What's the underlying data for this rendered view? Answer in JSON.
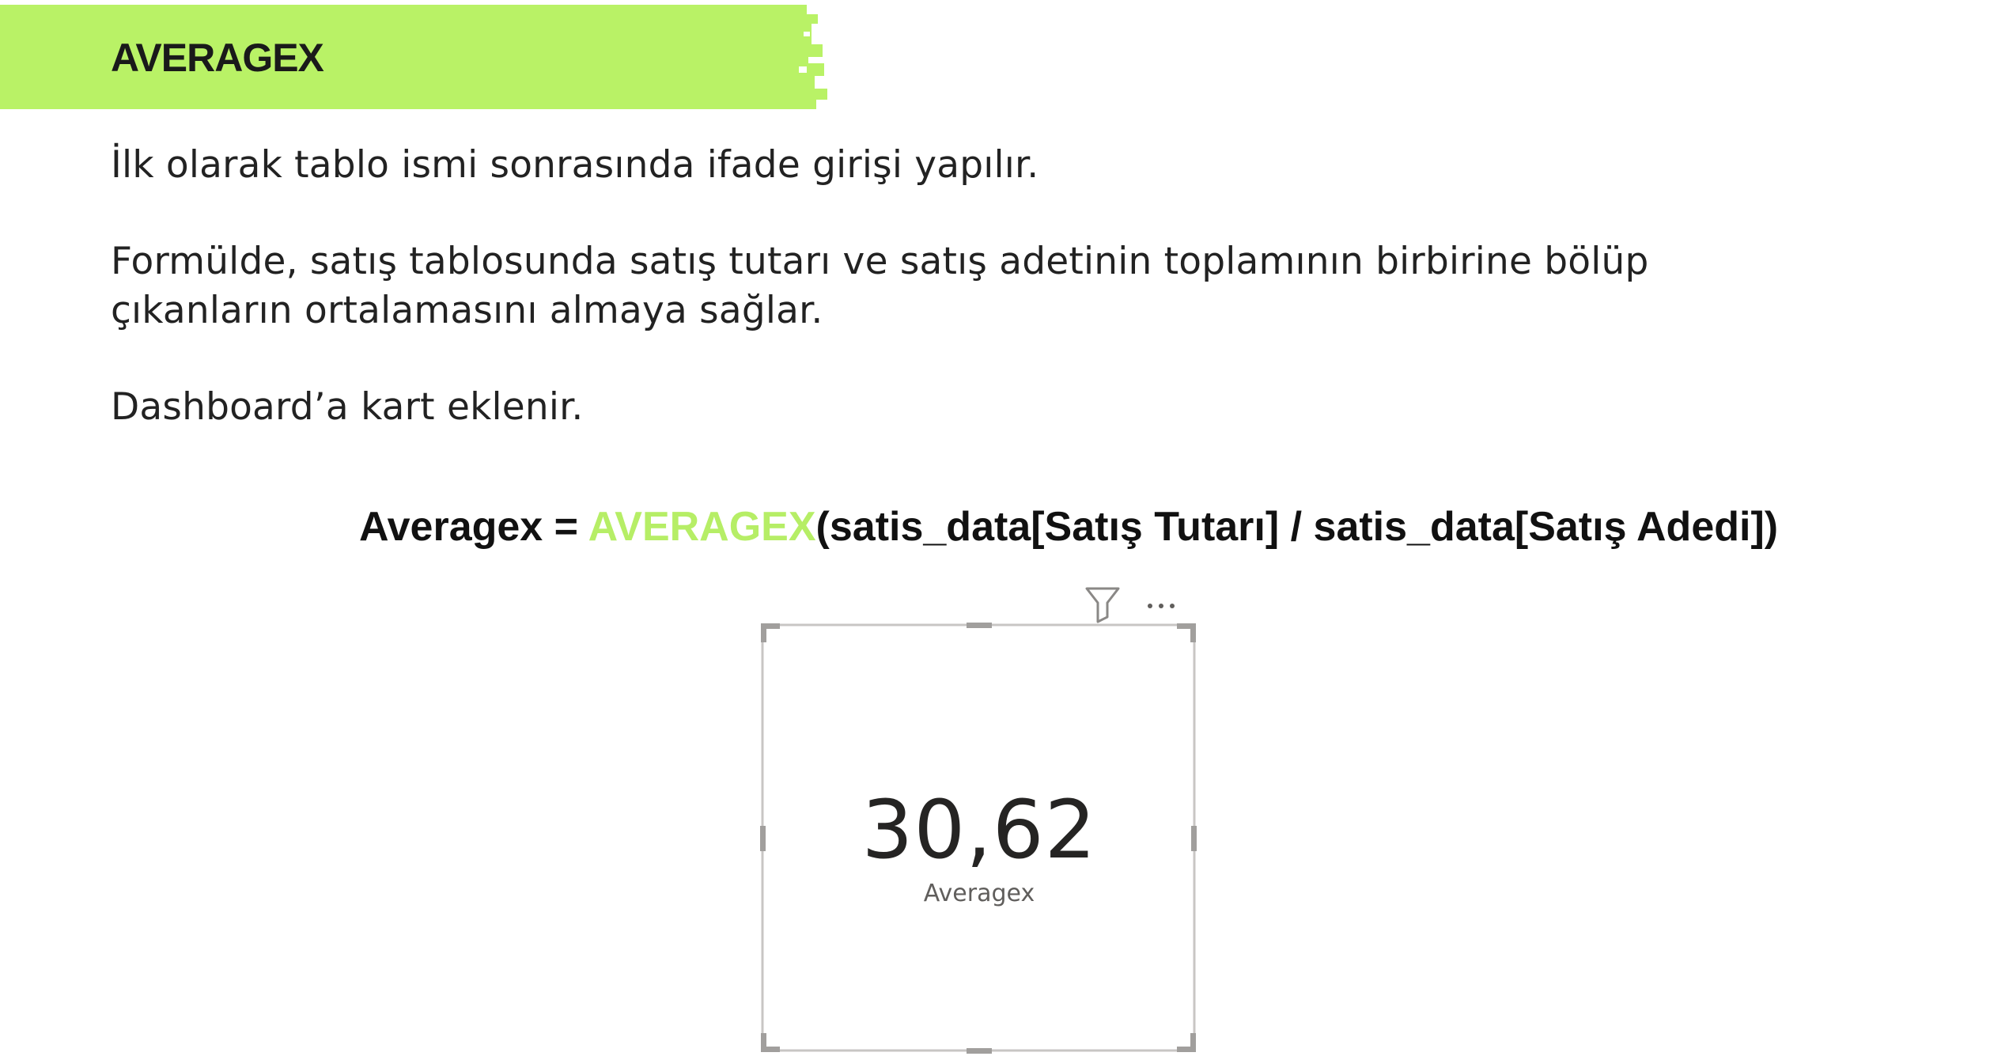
{
  "header": {
    "title": "AVERAGEX",
    "bar_color": "#b9f266"
  },
  "paragraphs": {
    "p1": "İlk olarak tablo ismi sonrasında ifade girişi yapılır.",
    "p2_line1": "Formülde, satış tablosunda satış tutarı ve satış adetinin toplamının birbirine bölüp",
    "p2_line2": "çıkanların ortalamasını almaya sağlar.",
    "p3": "Dashboard’a kart eklenir."
  },
  "formula": {
    "measure": "Averagex = ",
    "function": "AVERAGEX",
    "arguments": "(satis_data[Satış Tutarı] / satis_data[Satış Adedi])",
    "function_color": "#b6ee66"
  },
  "card": {
    "value": "30,62",
    "label": "Averagex",
    "toolbar_icons": [
      "filter-icon",
      "more-options-icon"
    ]
  }
}
